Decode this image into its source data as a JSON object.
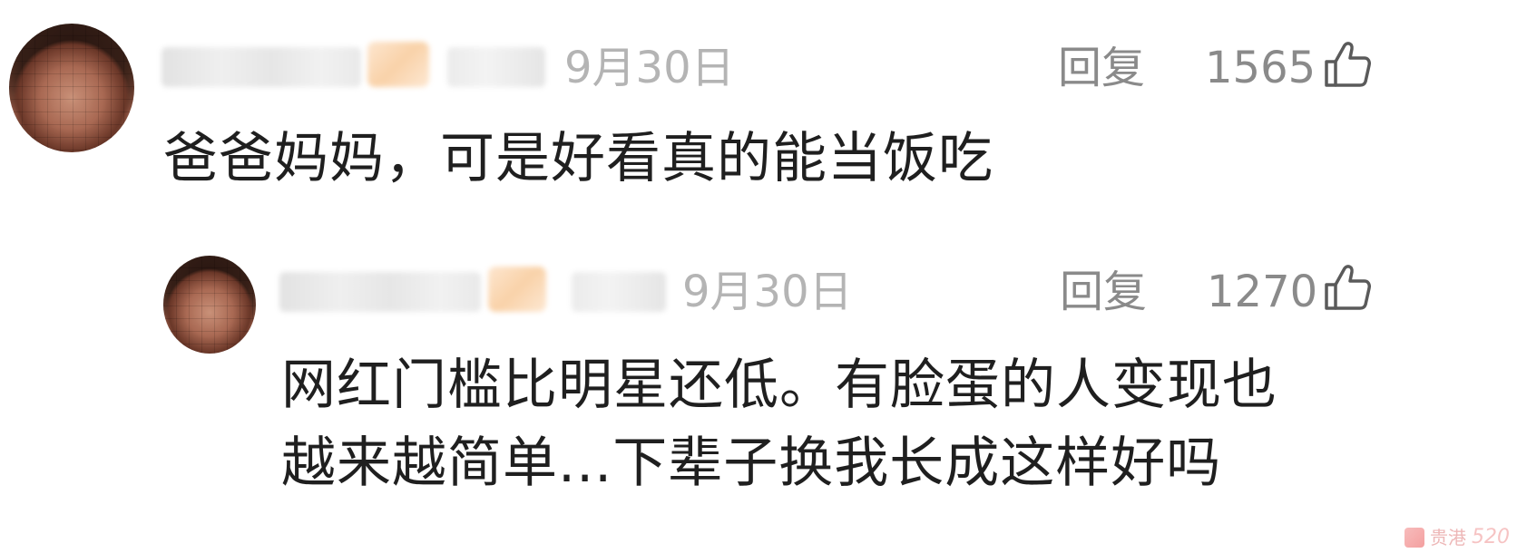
{
  "comments": [
    {
      "date": "9月30日",
      "reply_label": "回复",
      "like_count": "1565",
      "text": "爸爸妈妈，可是好看真的能当饭吃"
    },
    {
      "date": "9月30日",
      "reply_label": "回复",
      "like_count": "1270",
      "text_line1": "网红门槛比明星还低。有脸蛋的人变现也",
      "text_line2": "越来越简单...下辈子换我长成这样好吗"
    }
  ],
  "icons": {
    "like": "thumbs-up-icon",
    "avatar": "avatar",
    "watermark": "watermark-logo"
  },
  "colors": {
    "text": "#1f1f1f",
    "date": "#b4b4b4",
    "action": "#8a8a8a"
  },
  "watermark": {
    "text": "贵港",
    "suffix": "520"
  }
}
